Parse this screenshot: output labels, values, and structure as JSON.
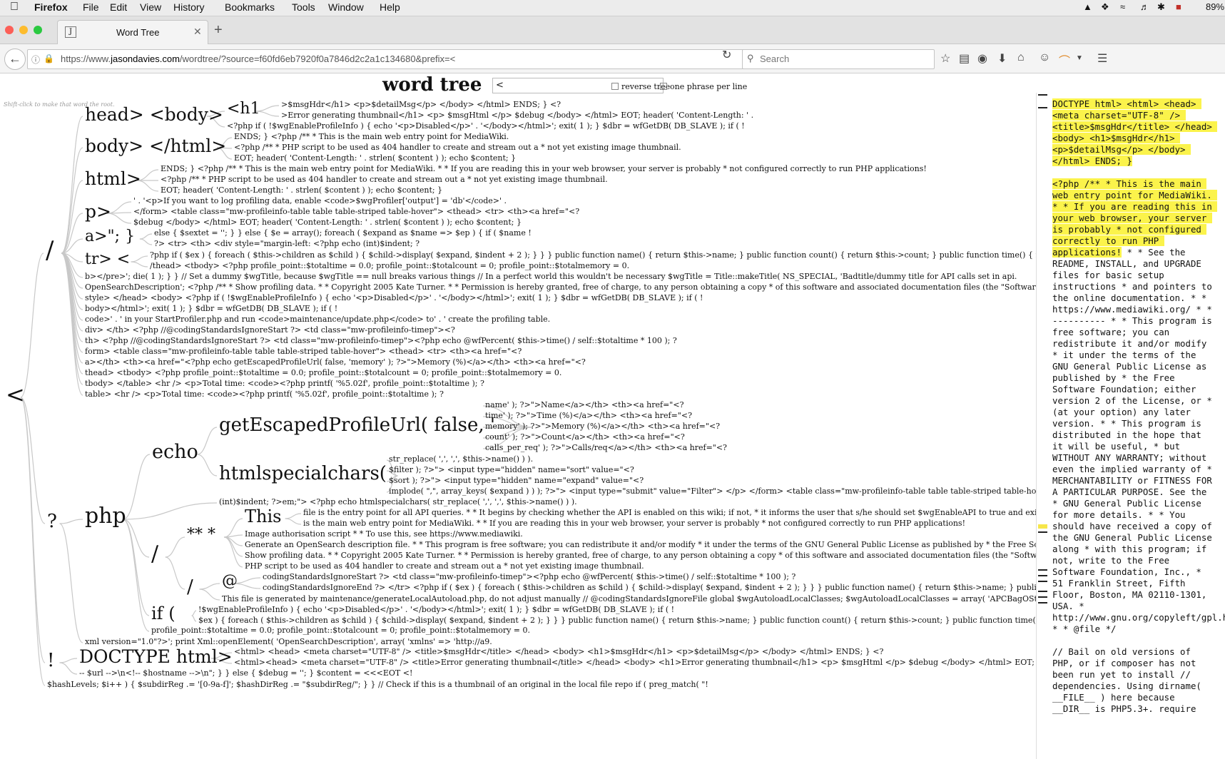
{
  "menubar": {
    "app": "Firefox",
    "items": [
      "File",
      "Edit",
      "View",
      "History",
      "Bookmarks",
      "Tools",
      "Window",
      "Help"
    ],
    "battery": "89%"
  },
  "browser": {
    "tab_title": "Word Tree",
    "tab_favicon": "J",
    "url_prefix": "https://www.",
    "url_domain": "jasondavies.com",
    "url_rest": "/wordtree/?source=f60fd6eb7920f0a7846d2c2a1c134680&prefix=<",
    "search_placeholder": "Search",
    "icons": [
      "back-icon",
      "info-icon",
      "lock-icon",
      "reload-icon",
      "search-icon",
      "bookmark-star-icon",
      "reading-list-icon",
      "pocket-icon",
      "download-icon",
      "home-icon",
      "chat-icon",
      "rainbow-icon",
      "menu-icon"
    ]
  },
  "page": {
    "title": "word tree",
    "prefix_value": "<",
    "reverse_label": "reverse tree",
    "phrase_label": "one phrase per line",
    "hint": "Shift-click to make that word the root."
  },
  "tree": {
    "root": "<",
    "nodes": [
      {
        "id": "n_slash",
        "text": "/"
      },
      {
        "id": "n_head",
        "text": "head> <body>"
      },
      {
        "id": "n_h1",
        "text": "<h1"
      },
      {
        "id": "l1",
        "text": ">$msgHdr</h1> <p>$detailMsg</p> </body> </html> ENDS; } <?"
      },
      {
        "id": "l2",
        "text": ">Error generating thumbnail</h1> <p> $msgHtml </p> $debug </body> </html> EOT; header( 'Content-Length: ' ."
      },
      {
        "id": "l3",
        "text": "<?php if ( !$wgEnableProfileInfo ) { echo '<p>Disabled</p>' . '</body></html>'; exit( 1 ); } $dbr = wfGetDB( DB_SLAVE ); if ( !"
      },
      {
        "id": "n_body",
        "text": "body> </html>"
      },
      {
        "id": "l4",
        "text": "ENDS; } <?php /** * This is the main web entry point for MediaWiki."
      },
      {
        "id": "l5",
        "text": "<?php /** * PHP script to be used as 404 handler to create and stream out a * not yet existing image thumbnail."
      },
      {
        "id": "l6",
        "text": "EOT; header( 'Content-Length: ' . strlen( $content ) ); echo $content; }"
      },
      {
        "id": "n_html",
        "text": "html>"
      },
      {
        "id": "l7",
        "text": "ENDS; } <?php /** * This is the main web entry point for MediaWiki. * * If you are reading this in your web browser, your server is probably * not configured correctly to run PHP applications!"
      },
      {
        "id": "l8",
        "text": "<?php /** * PHP script to be used as 404 handler to create and stream out a * not yet existing image thumbnail."
      },
      {
        "id": "l9",
        "text": "EOT; header( 'Content-Length: ' . strlen( $content ) ); echo $content; }"
      },
      {
        "id": "n_p",
        "text": "p>"
      },
      {
        "id": "l10",
        "text": "' . '<p>If you want to log profiling data, enable <code>$wgProfiler['output'] = 'db'</code>' ."
      },
      {
        "id": "l11",
        "text": "</form> <table class=\"mw-profileinfo-table table table-striped table-hover\"> <thead> <tr> <th><a href=\"<?"
      },
      {
        "id": "l12",
        "text": "$debug </body> </html> EOT; header( 'Content-Length: ' . strlen( $content ) ); echo $content; }"
      },
      {
        "id": "n_a",
        "text": "a>\"; }"
      },
      {
        "id": "l13",
        "text": "else { $sextet = ''; } } else { $e = array(); foreach ( $expand as $name => $ep ) { if ( $name !"
      },
      {
        "id": "l14",
        "text": "?> <tr> <th> <div style=\"margin-left: <?php echo (int)$indent; ?"
      },
      {
        "id": "n_tr",
        "text": "tr> <"
      },
      {
        "id": "l15",
        "text": "?php if ( $ex ) { foreach ( $this->children as $child ) { $child->display( $expand, $indent + 2 ); } } } public function name() { return $this->name; } public function count() { return $this->count; } public function time() { return $this->"
      },
      {
        "id": "l16",
        "text": "/thead> <tbody> <?php profile_point::$totaltime = 0.0; profile_point::$totalcount = 0; profile_point::$totalmemory = 0."
      },
      {
        "id": "l17",
        "text": "b></pre>'; die( 1 ); } } // Set a dummy $wgTitle, because $wgTitle == null breaks various things // In a perfect world this wouldn't be necessary $wgTitle = Title::makeTitle( NS_SPECIAL, 'Badtitle/dummy title for API calls set in api."
      },
      {
        "id": "l18",
        "text": "OpenSearchDescription'; <?php /** * Show profiling data. * * Copyright 2005 Kate Turner. * * Permission is hereby granted, free of charge, to any person obtaining a copy * of this software and associated documentation files (the \"Software\"), to deal * i"
      },
      {
        "id": "l19",
        "text": "style> </head> <body> <?php if ( !$wgEnableProfileInfo ) { echo '<p>Disabled</p>' . '</body></html>'; exit( 1 ); } $dbr = wfGetDB( DB_SLAVE ); if ( !"
      },
      {
        "id": "l20",
        "text": "body></html>'; exit( 1 ); } $dbr = wfGetDB( DB_SLAVE ); if ( !"
      },
      {
        "id": "l21",
        "text": "code>' . ' in your StartProfiler.php and run <code>maintenance/update.php</code> to' . ' create the profiling table."
      },
      {
        "id": "l22",
        "text": "div> </th> <?php //@codingStandardsIgnoreStart ?> <td class=\"mw-profileinfo-timep\"><?"
      },
      {
        "id": "l23",
        "text": "th> <?php //@codingStandardsIgnoreStart ?> <td class=\"mw-profileinfo-timep\"><?php echo @wfPercent( $this->time() / self::$totaltime * 100 ); ?"
      },
      {
        "id": "l24",
        "text": "form> <table class=\"mw-profileinfo-table table table-striped table-hover\"> <thead> <tr> <th><a href=\"<?"
      },
      {
        "id": "l25",
        "text": "a></th> <th><a href=\"<?php echo getEscapedProfileUrl( false, 'memory' ); ?>\">Memory (%)</a></th> <th><a href=\"<?"
      },
      {
        "id": "l26",
        "text": "thead> <tbody> <?php profile_point::$totaltime = 0.0; profile_point::$totalcount = 0; profile_point::$totalmemory = 0."
      },
      {
        "id": "l27",
        "text": "tbody> </table> <hr /> <p>Total time: <code><?php printf( '%5.02f', profile_point::$totaltime ); ?"
      },
      {
        "id": "l28",
        "text": "table> <hr /> <p>Total time: <code><?php printf( '%5.02f', profile_point::$totaltime ); ?"
      },
      {
        "id": "n_q",
        "text": "?"
      },
      {
        "id": "n_php",
        "text": "php"
      },
      {
        "id": "n_echo",
        "text": "echo"
      },
      {
        "id": "n_gep",
        "text": "getEscapedProfileUrl( false, '"
      },
      {
        "id": "l29",
        "text": "name' ); ?>\">Name</a></th> <th><a href=\"<?"
      },
      {
        "id": "l30",
        "text": "time' ); ?>\">Time (%)</a></th> <th><a href=\"<?"
      },
      {
        "id": "l31",
        "text": "memory' ); ?>\">Memory (%)</a></th> <th><a href=\"<?"
      },
      {
        "id": "l32",
        "text": "count' ); ?>\">Count</a></th> <th><a href=\"<?"
      },
      {
        "id": "l33",
        "text": "calls_per_req' ); ?>\">Calls/req</a></th> <th><a href=\"<?"
      },
      {
        "id": "n_hsc",
        "text": "htmlspecialchars("
      },
      {
        "id": "l34",
        "text": "str_replace( ',', ',', $this->name() ) )."
      },
      {
        "id": "l35",
        "text": "$filter ); ?>\"> <input type=\"hidden\" name=\"sort\" value=\"<?"
      },
      {
        "id": "l36",
        "text": "$sort ); ?>\"> <input type=\"hidden\" name=\"expand\" value=\"<?"
      },
      {
        "id": "l37",
        "text": "implode( \",\", array_keys( $expand ) ) ); ?>\"> <input type=\"submit\" value=\"Filter\"> </p> </form> <table class=\"mw-profileinfo-table table table-striped table-hove"
      },
      {
        "id": "l38",
        "text": "(int)$indent; ?>em;\"> <?php echo htmlspecialchars( str_replace( ',', ',', $this->name() ) )."
      },
      {
        "id": "n_slash2",
        "text": "/"
      },
      {
        "id": "n_stars",
        "text": "** *"
      },
      {
        "id": "n_this",
        "text": "This"
      },
      {
        "id": "l39",
        "text": "file is the entry point for all API queries. * * It begins by checking whether the API is enabled on this wiki; if not, * it informs the user that s/he should set $wgEnableAPI to true and exits."
      },
      {
        "id": "l40",
        "text": "is the main web entry point for MediaWiki. * * If you are reading this in your web browser, your server is probably * not configured correctly to run PHP applications!"
      },
      {
        "id": "l41",
        "text": "Image authorisation script * * To use this, see https://www.mediawiki."
      },
      {
        "id": "l42",
        "text": "Generate an OpenSearch description file. * * This program is free software; you can redistribute it and/or modify * it under the terms of the GNU General Public License as published by * the Free Software F"
      },
      {
        "id": "l43",
        "text": "Show profiling data. * * Copyright 2005 Kate Turner. * * Permission is hereby granted, free of charge, to any person obtaining a copy * of this software and associated documentation files (the \"Software\"), to"
      },
      {
        "id": "l44",
        "text": "PHP script to be used as 404 handler to create and stream out a * not yet existing image thumbnail."
      },
      {
        "id": "n_slash3",
        "text": "/"
      },
      {
        "id": "n_at",
        "text": "@"
      },
      {
        "id": "l45",
        "text": "codingStandardsIgnoreStart ?> <td class=\"mw-profileinfo-timep\"><?php echo @wfPercent( $this->time() / self::$totaltime * 100 ); ?"
      },
      {
        "id": "l46",
        "text": "codingStandardsIgnoreEnd ?> </tr> <?php if ( $ex ) { foreach ( $this->children as $child ) { $child->display( $expand, $indent + 2 ); } } } public function name() { return $this->name; } public functio"
      },
      {
        "id": "l47",
        "text": "This file is generated by maintenance/generateLocalAutoload.php, do not adjust manually // @codingStandardsIgnoreFile global $wgAutoloadLocalClasses; $wgAutoloadLocalClasses = array( 'APCBagOStuff' =>"
      },
      {
        "id": "n_if",
        "text": "if ("
      },
      {
        "id": "l48",
        "text": "!$wgEnableProfileInfo ) { echo '<p>Disabled</p>' . '</body></html>'; exit( 1 ); } $dbr = wfGetDB( DB_SLAVE ); if ( !"
      },
      {
        "id": "l49",
        "text": "$ex ) { foreach ( $this->children as $child ) { $child->display( $expand, $indent + 2 ); } } } public function name() { return $this->name; } public function count() { return $this->count; } public function time() { return $t"
      },
      {
        "id": "l50",
        "text": "profile_point::$totaltime = 0.0; profile_point::$totalcount = 0; profile_point::$totalmemory = 0."
      },
      {
        "id": "l51",
        "text": "xml version=\"1.0\"?>'; print Xml::openElement( 'OpenSearchDescription', array( 'xmlns' => 'http://a9."
      },
      {
        "id": "n_bang",
        "text": "!"
      },
      {
        "id": "n_doctype",
        "text": "DOCTYPE html>"
      },
      {
        "id": "l52",
        "text": "<html> <head> <meta charset=\"UTF-8\" /> <title>$msgHdr</title> </head> <body> <h1>$msgHdr</h1> <p>$detailMsg</p> </body> </html> ENDS; } <?"
      },
      {
        "id": "l53",
        "text": "<html><head> <meta charset=\"UTF-8\" /> <title>Error generating thumbnail</title> </head> <body> <h1>Error generating thumbnail</h1> <p> $msgHtml </p> $debug </body> </html> EOT; header( 'C"
      },
      {
        "id": "l54",
        "text": "-- $url -->\\n<!-- $hostname -->\\n\"; } } else { $debug = ''; } $content = <<<EOT <!"
      },
      {
        "id": "l55",
        "text": "$hashLevels; $i++ ) { $subdirReg .= '[0-9a-f]'; $hashDirReg .= \"$subdirReg/\"; } } // Check if this is a thumbnail of an original in the local file repo if ( preg_match( \"!"
      }
    ]
  },
  "source_text": {
    "highlight1": "DOCTYPE html> <html> <head> <meta charset=\"UTF-8\" /> <title>$msgHdr</title> </head> <body> <h1>$msgHdr</h1> <p>$detailMsg</p> </body> </html> ENDS; }",
    "highlight2": "<?php /** * This is the main web entry point for MediaWiki. * * If you are reading this in your web browser, your server is probably * not configured correctly to run PHP applications!",
    "body1": " * * See the README, INSTALL, and UPGRADE files for basic setup instructions * and pointers to the online documentation. * * https://www.mediawiki.org/ * * ---------- * * This program is free software; you can redistribute it and/or modify * it under the terms of the GNU General Public License as published by * the Free Software Foundation; either version 2 of the License, or * (at your option) any later version. * * This program is distributed in the hope that it will be useful, * but WITHOUT ANY WARRANTY; without even the implied warranty of * MERCHANTABILITY or FITNESS FOR A PARTICULAR PURPOSE. See the * GNU General Public License for more details. * * You should have received a copy of the GNU General Public License along * with this program; if not, write to the Free Software Foundation, Inc., * 51 Franklin Street, Fifth Floor, Boston, MA 02110-1301, USA. * http://www.gnu.org/copyleft/gpl.html * * @file */",
    "body2": "// Bail on old versions of PHP, or if composer has not been run yet to install // dependencies. Using dirname( __FILE__ ) here because __DIR__ is PHP5.3+. require"
  }
}
